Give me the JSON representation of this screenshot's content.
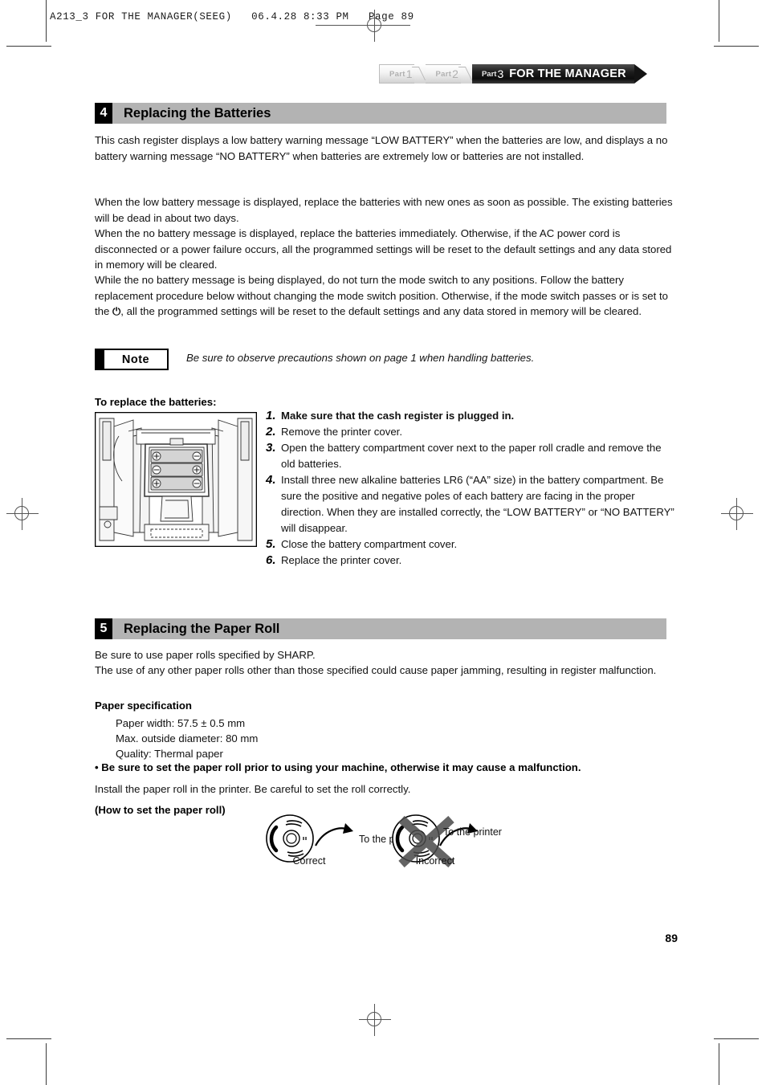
{
  "print_header": {
    "text": "A213_3 FOR THE MANAGER(SEEG)   06.4.28 8:33 PM   Page 89"
  },
  "banner": {
    "tabs": [
      {
        "label": "Part",
        "number": "1"
      },
      {
        "label": "Part",
        "number": "2"
      }
    ],
    "active": {
      "label": "Part",
      "number": "3",
      "title": "FOR THE MANAGER"
    }
  },
  "sections": [
    {
      "number": "4",
      "title": "Replacing the Batteries",
      "paragraphs": [
        "This cash register displays a low battery warning message “LOW BATTERY” when the batteries are low, and displays a no battery warning message “NO BATTERY” when batteries are extremely low or batteries are not installed.",
        "When the low battery message is displayed, replace the batteries with new ones as soon as possible.  The existing batteries will be dead in about two days.",
        "When the no battery message is displayed, replace the batteries immediately.  Otherwise, if the AC power cord is disconnected or a power failure occurs, all the programmed settings will be reset to the default settings and any data stored in memory will be cleared.",
        "While the no battery message is being displayed, do not turn the mode switch to any positions.  Follow the battery replacement procedure below without changing the mode switch position.  Otherwise, if the mode switch passes or is set to the ",
        ", all the programmed settings will be reset to the default settings and any data stored in memory will be cleared."
      ],
      "power_symbol": "⏻"
    },
    {
      "number": "5",
      "title": "Replacing the Paper Roll"
    }
  ],
  "note": {
    "label": "Note",
    "text": "Be sure to observe precautions shown on page 1 when handling batteries."
  },
  "procedure": {
    "heading": "To replace the batteries:",
    "steps": [
      {
        "n": "1.",
        "text": "Make sure that the cash register is plugged in.",
        "bold": true
      },
      {
        "n": "2.",
        "text": "Remove the printer cover.",
        "bold": false
      },
      {
        "n": "3.",
        "text": "Open the battery compartment cover next to the paper roll cradle and remove the old batteries.",
        "bold": false
      },
      {
        "n": "4.",
        "text": "Install three new alkaline batteries LR6 (“AA” size) in the battery compartment.  Be sure the positive and negative poles of each battery are facing in the proper direction.  When they are installed correctly, the “LOW BATTERY” or “NO BATTERY” will disappear.",
        "bold": false
      },
      {
        "n": "5.",
        "text": "Close the battery compartment cover.",
        "bold": false
      },
      {
        "n": "6.",
        "text": "Replace the printer cover.",
        "bold": false
      }
    ]
  },
  "paper_roll": {
    "intro": [
      "Be sure to use paper rolls specified by SHARP.",
      "The use of any other paper rolls other than those specified could cause paper jamming, resulting in register malfunction."
    ],
    "spec_heading": "Paper specification",
    "specs": [
      "Paper width: 57.5 ± 0.5 mm",
      "Max. outside diameter: 80 mm",
      "Quality: Thermal paper"
    ],
    "bullet_warning": "• Be sure to set the paper roll prior to using your machine, otherwise it may cause a malfunction.",
    "install_note": "Install the paper roll in the printer.  Be careful to set the roll correctly.",
    "how_to_heading": "(How to set the paper roll)",
    "figure": {
      "correct_arrow_label": "To the printer",
      "correct_caption": "Correct",
      "incorrect_arrow_label": "To the printer",
      "incorrect_caption": "Incorrect"
    }
  },
  "page_number": "89",
  "colors": {
    "section_bar": "#b3b3b3",
    "section_number_bg": "#000000",
    "banner_dark": "#141414",
    "text": "#111111"
  }
}
